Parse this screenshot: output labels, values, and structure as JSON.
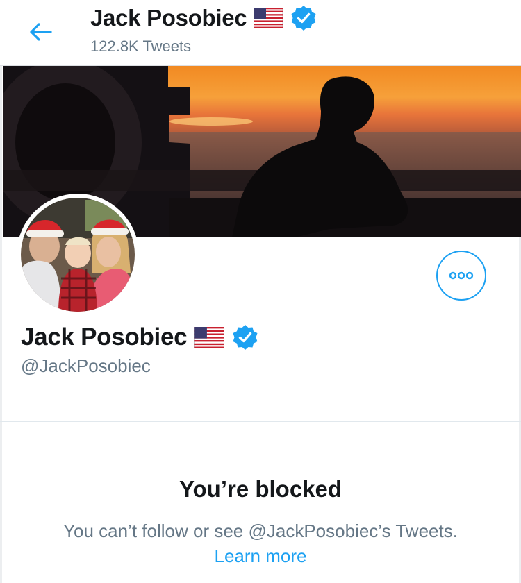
{
  "header": {
    "name": "Jack Posobiec",
    "tweet_count": "122.8K Tweets"
  },
  "profile": {
    "name": "Jack Posobiec",
    "handle": "@JackPosobiec"
  },
  "blocked": {
    "title": "You’re blocked",
    "message": "You can’t follow or see @JackPosobiec’s Tweets.",
    "link": "Learn more"
  },
  "icons": {
    "back": "arrow-left-icon",
    "flag": "us-flag-icon",
    "verified": "verified-badge-icon",
    "more": "more-options-icon"
  },
  "colors": {
    "accent": "#1da1f2",
    "text": "#14171a",
    "secondary": "#657786"
  }
}
